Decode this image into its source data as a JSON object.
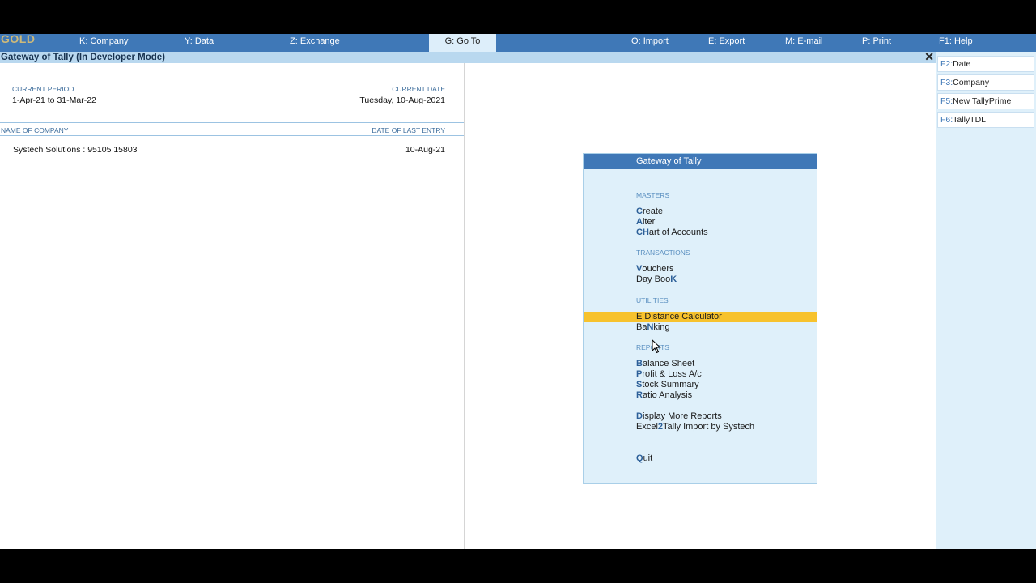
{
  "topbar": {
    "logo": "GOLD",
    "menus": [
      {
        "key": "K",
        "label": "Company"
      },
      {
        "key": "Y",
        "label": "Data"
      },
      {
        "key": "Z",
        "label": "Exchange"
      },
      {
        "key": "G",
        "label": "Go To"
      },
      {
        "key": "O",
        "label": "Import"
      },
      {
        "key": "E",
        "label": "Export"
      },
      {
        "key": "M",
        "label": "E-mail"
      },
      {
        "key": "P",
        "label": "Print"
      },
      {
        "key": "F1",
        "label": "Help"
      }
    ]
  },
  "titlebar": {
    "title": "Gateway of Tally (In Developer Mode)",
    "close": "✕"
  },
  "left": {
    "current_period_label": "CURRENT PERIOD",
    "current_period": "1-Apr-21 to 31-Mar-22",
    "current_date_label": "CURRENT DATE",
    "current_date": "Tuesday, 10-Aug-2021",
    "name_label": "NAME OF COMPANY",
    "last_entry_label": "DATE OF LAST ENTRY",
    "company_name": "Systech Solutions : 95105 15803",
    "last_entry": "10-Aug-21"
  },
  "gateway": {
    "title": "Gateway of Tally",
    "sections": {
      "masters": "MASTERS",
      "transactions": "TRANSACTIONS",
      "utilities": "UTILITIES",
      "reports": "REPORTS"
    },
    "items": {
      "create": {
        "k": "C",
        "rest": "reate"
      },
      "alter": {
        "k": "A",
        "rest": "lter"
      },
      "chart": {
        "k": "CH",
        "rest": "art of Accounts"
      },
      "vouchers": {
        "k": "V",
        "rest": "ouchers"
      },
      "daybook_a": "Day Boo",
      "daybook_k": "K",
      "edistance": {
        "k": "E",
        "rest": " Distance Calculator"
      },
      "banking_a": "Ba",
      "banking_k": "N",
      "banking_b": "king",
      "balance": {
        "k": "B",
        "rest": "alance Sheet"
      },
      "pnl": {
        "k": "P",
        "rest": "rofit & Loss A/c"
      },
      "stock": {
        "k": "S",
        "rest": "tock Summary"
      },
      "ratio": {
        "k": "R",
        "rest": "atio Analysis"
      },
      "more": {
        "k": "D",
        "rest": "isplay More Reports"
      },
      "excel_a": "Excel",
      "excel_k": "2",
      "excel_b": "Tally Import by Systech",
      "quit": {
        "k": "Q",
        "rest": "uit"
      }
    }
  },
  "right": {
    "buttons": [
      {
        "key": "F2:",
        "label": "Date"
      },
      {
        "key": "F3:",
        "label": "Company"
      },
      {
        "key": "F5:",
        "label": "New TallyPrime"
      },
      {
        "key": "F6:",
        "label": "TallyTDL"
      }
    ]
  },
  "colors": {
    "bar": "#3f78b7",
    "highlight": "#f7c22d",
    "panel": "#dff0fa"
  }
}
